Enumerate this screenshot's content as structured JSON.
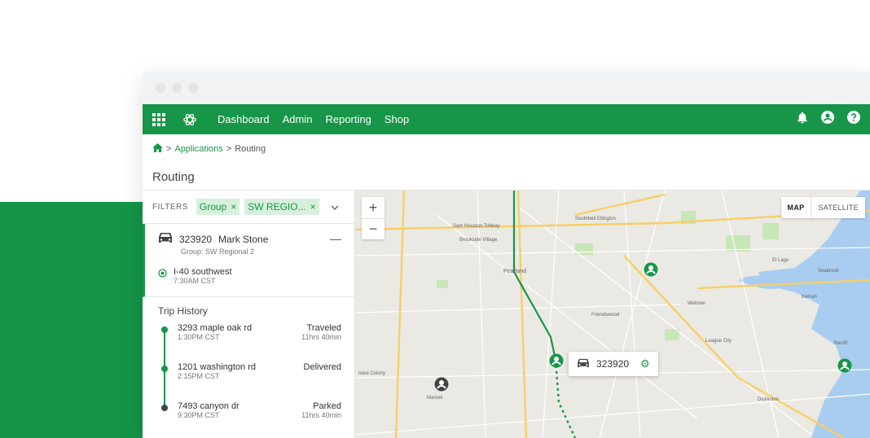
{
  "nav": {
    "links": [
      "Dashboard",
      "Admin",
      "Reporting",
      "Shop"
    ],
    "brand_color": "#179649"
  },
  "breadcrumb": {
    "applications": "Applications",
    "current": "Routing",
    "sep": ">"
  },
  "page": {
    "title": "Routing"
  },
  "filters": {
    "label": "FILTERS",
    "chips": [
      "Group",
      "SW REGIO..."
    ]
  },
  "vehicle": {
    "id": "323920",
    "driver": "Mark Stone",
    "group": "Group: SW Regional 2",
    "location": "I-40 southwest",
    "location_time": "7:30AM CST"
  },
  "history": {
    "title": "Trip History",
    "items": [
      {
        "address": "3293 maple oak rd",
        "time": "1:30PM CST",
        "status": "Traveled",
        "duration": "11hrs 40min"
      },
      {
        "address": "1201 washington rd",
        "time": "2:15PM CST",
        "status": "Delivered",
        "duration": ""
      },
      {
        "address": "7493 canyon dr",
        "time": "9:30PM CST",
        "status": "Parked",
        "duration": "11hrs 40min"
      }
    ]
  },
  "map": {
    "type_options": [
      "MAP",
      "SATELLITE"
    ],
    "vehicle_label": "323920",
    "places": [
      "Brookside Village",
      "Pearland",
      "Friendswood",
      "El Lago",
      "Seabrook",
      "Webster",
      "League City",
      "Kemah",
      "Bacliff",
      "Iowa Colony",
      "Manvel",
      "Dickinson",
      "Sam Houston Tollway",
      "Southbelt Ellington"
    ]
  }
}
